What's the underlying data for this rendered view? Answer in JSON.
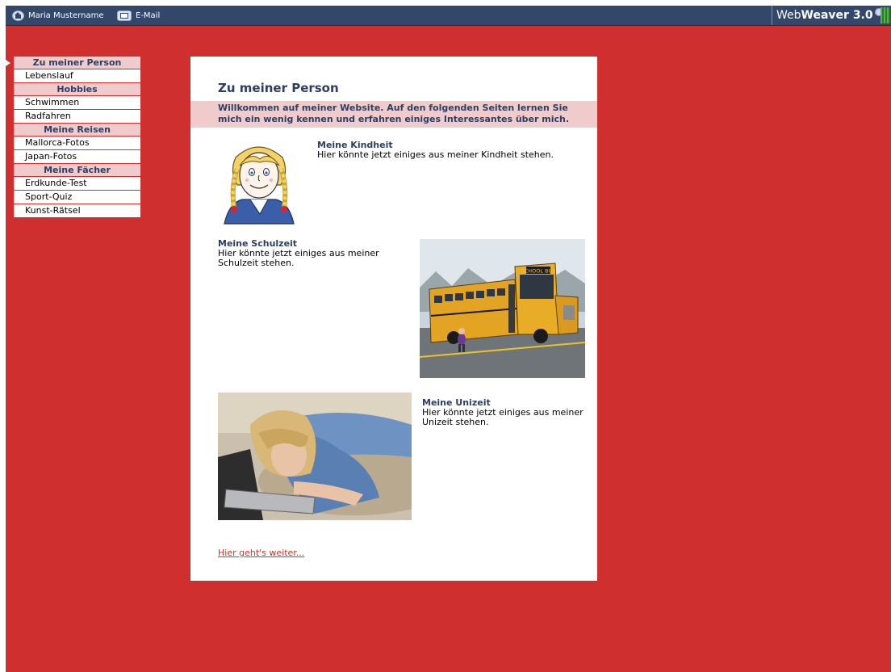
{
  "topbar": {
    "user_name": "Maria Mustername",
    "email_label": "E-Mail",
    "brand_web": "Web",
    "brand_weaver": "Weaver 3.0"
  },
  "sidebar": {
    "groups": [
      {
        "heading": "Zu meiner Person",
        "items": [
          "Lebenslauf"
        ]
      },
      {
        "heading": "Hobbies",
        "items": [
          "Schwimmen",
          "Radfahren"
        ]
      },
      {
        "heading": "Meine Reisen",
        "items": [
          "Mallorca-Fotos",
          "Japan-Fotos"
        ]
      },
      {
        "heading": "Meine Fächer",
        "items": [
          "Erdkunde-Test",
          "Sport-Quiz",
          "Kunst-Rätsel"
        ]
      }
    ]
  },
  "main": {
    "title": "Zu meiner Person",
    "welcome": "Willkommen auf meiner Website. Auf den folgenden Seiten lernen Sie mich ein wenig kennen und erfahren einiges Interessantes über mich.",
    "sections": [
      {
        "title": "Meine Kindheit",
        "text": "Hier könnte jetzt einiges aus meiner Kindheit stehen."
      },
      {
        "title": "Meine Schulzeit",
        "text": "Hier könnte jetzt einiges aus meiner Schulzeit stehen."
      },
      {
        "title": "Meine Unizeit",
        "text": "Hier könnte jetzt einiges aus meiner Unizeit stehen."
      }
    ],
    "bus_sign": "SCHOOL BUS",
    "next_link": "Hier geht's weiter..."
  },
  "colors": {
    "page_background": "#cf2f2f",
    "topbar": "#33476b",
    "heading_text": "#2c3e63",
    "highlight_band": "#efcbcc",
    "link": "#c0392b"
  }
}
